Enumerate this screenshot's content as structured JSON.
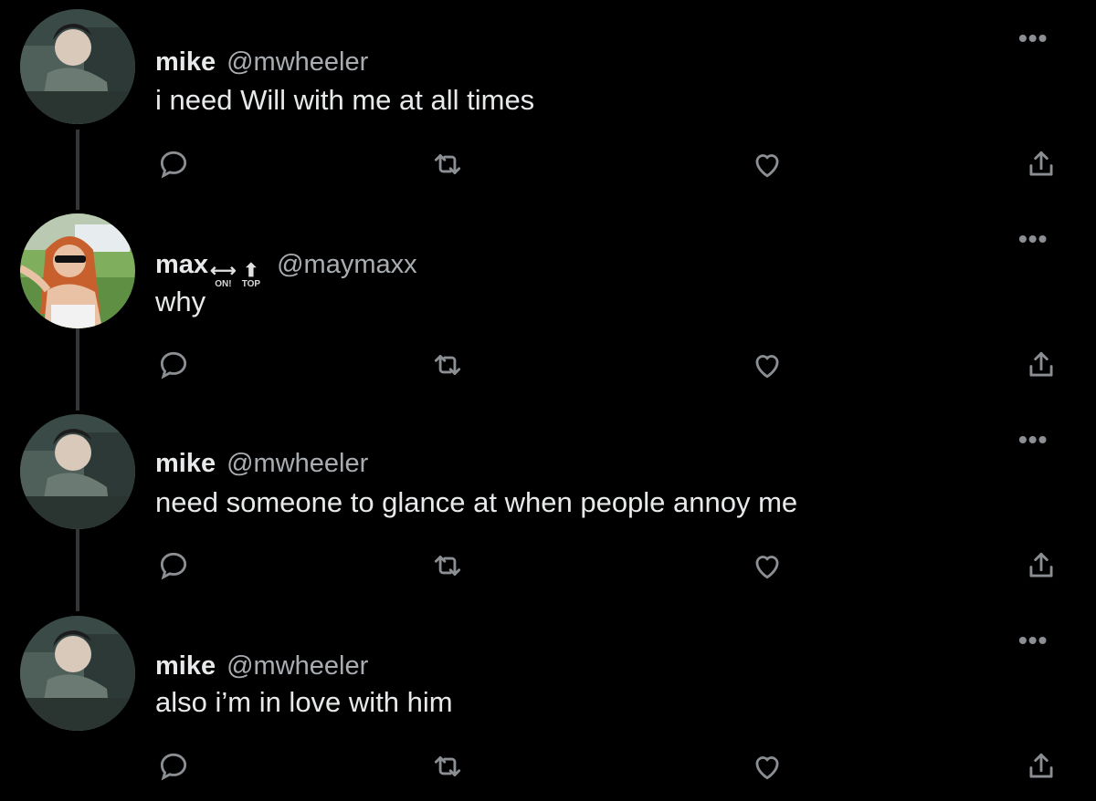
{
  "tweets": [
    {
      "name": "mike",
      "handle": "@mwheeler",
      "text": "i need  Will with me at all times",
      "avatar": "mike-avatar"
    },
    {
      "name": "max",
      "badges": [
        {
          "icon": "left-right-arrow-icon",
          "label": "ON!"
        },
        {
          "icon": "up-arrow-icon",
          "label": "TOP"
        }
      ],
      "handle": "@maymaxx",
      "text": "why",
      "avatar": "max-avatar"
    },
    {
      "name": "mike",
      "handle": "@mwheeler",
      "text": "need someone to glance at when people annoy me",
      "avatar": "mike-avatar"
    },
    {
      "name": "mike",
      "handle": "@mwheeler",
      "text": "also i’m in love with him",
      "avatar": "mike-avatar"
    }
  ],
  "actions": [
    "reply-icon",
    "retweet-icon",
    "like-icon",
    "share-icon"
  ],
  "more_glyph": "•••",
  "colors": {
    "background": "#000000",
    "text": "#e7e9ea",
    "handle": "#a9adb1",
    "icon": "#8b8f93",
    "thread_line": "#333639"
  }
}
